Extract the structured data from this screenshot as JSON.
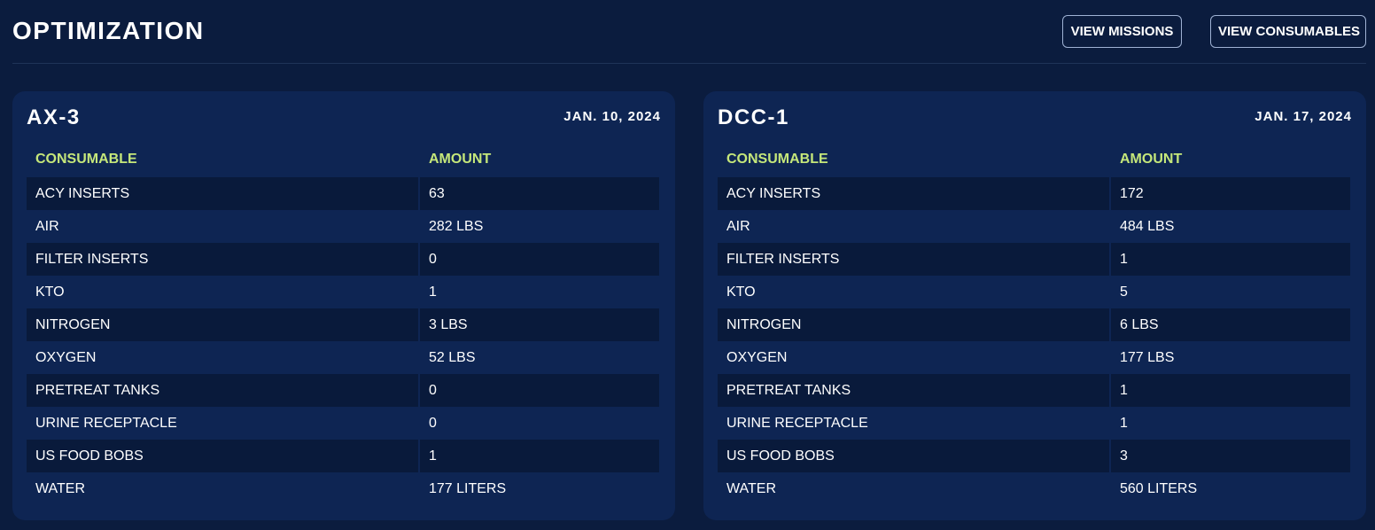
{
  "header": {
    "title": "OPTIMIZATION",
    "view_missions_label": "VIEW MISSIONS",
    "view_consumables_label": "VIEW CONSUMABLES"
  },
  "missions": [
    {
      "name": "AX-3",
      "date": "JAN. 10, 2024",
      "columns": [
        "CONSUMABLE",
        "AMOUNT"
      ],
      "rows": [
        [
          "ACY INSERTS",
          "63"
        ],
        [
          "AIR",
          "282 LBS"
        ],
        [
          "FILTER INSERTS",
          "0"
        ],
        [
          "KTO",
          "1"
        ],
        [
          "NITROGEN",
          "3 LBS"
        ],
        [
          "OXYGEN",
          "52 LBS"
        ],
        [
          "PRETREAT TANKS",
          "0"
        ],
        [
          "URINE RECEPTACLE",
          "0"
        ],
        [
          "US FOOD BOBS",
          "1"
        ],
        [
          "WATER",
          "177 LITERS"
        ]
      ]
    },
    {
      "name": "DCC-1",
      "date": "JAN. 17, 2024",
      "columns": [
        "CONSUMABLE",
        "AMOUNT"
      ],
      "rows": [
        [
          "ACY INSERTS",
          "172"
        ],
        [
          "AIR",
          "484 LBS"
        ],
        [
          "FILTER INSERTS",
          "1"
        ],
        [
          "KTO",
          "5"
        ],
        [
          "NITROGEN",
          "6 LBS"
        ],
        [
          "OXYGEN",
          "177 LBS"
        ],
        [
          "PRETREAT TANKS",
          "1"
        ],
        [
          "URINE RECEPTACLE",
          "1"
        ],
        [
          "US FOOD BOBS",
          "3"
        ],
        [
          "WATER",
          "560 LITERS"
        ]
      ]
    }
  ],
  "colors": {
    "background": "#0b1c3e",
    "card": "#0e2553",
    "striped_row": "#091a3b",
    "header_accent": "#c5e77a"
  }
}
